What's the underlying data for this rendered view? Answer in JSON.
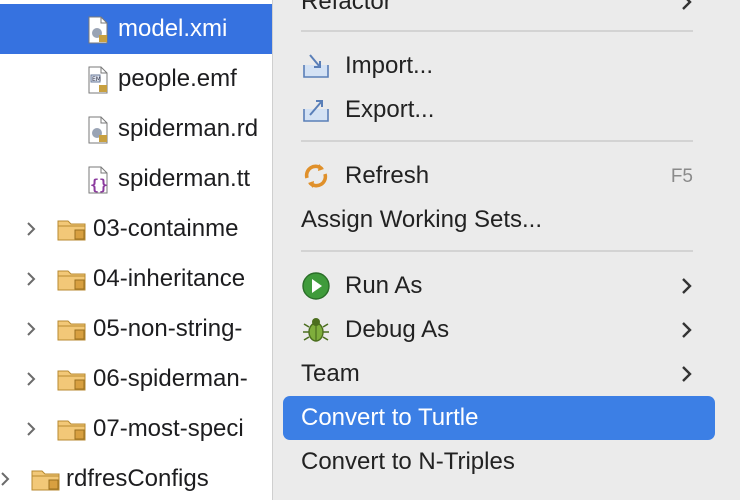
{
  "tree": {
    "files": [
      {
        "name": "model.xmi",
        "icon": "xmi-file-icon",
        "selected": true
      },
      {
        "name": "people.emf",
        "icon": "emf-file-icon",
        "selected": false
      },
      {
        "name": "spiderman.rd",
        "icon": "rdf-file-icon",
        "selected": false
      },
      {
        "name": "spiderman.tt",
        "icon": "ttl-file-icon",
        "selected": false
      }
    ],
    "folders": [
      {
        "name": "03-containme",
        "icon": "folder-icon"
      },
      {
        "name": "04-inheritance",
        "icon": "folder-icon"
      },
      {
        "name": "05-non-string-",
        "icon": "folder-icon"
      },
      {
        "name": "06-spiderman-",
        "icon": "folder-icon"
      },
      {
        "name": "07-most-speci",
        "icon": "folder-icon"
      },
      {
        "name": "rdfresConfigs",
        "icon": "folder-icon"
      }
    ]
  },
  "menu": {
    "refactor": "Refactor",
    "import": "Import...",
    "export": "Export...",
    "refresh": "Refresh",
    "refresh_shortcut": "F5",
    "assign_working_sets": "Assign Working Sets...",
    "run_as": "Run As",
    "debug_as": "Debug As",
    "team": "Team",
    "convert_turtle": "Convert to Turtle",
    "convert_ntriples": "Convert to N-Triples"
  },
  "colors": {
    "selection": "#3672e0",
    "menu_highlight": "#3c7fe5",
    "menu_background": "#ebebeb"
  }
}
